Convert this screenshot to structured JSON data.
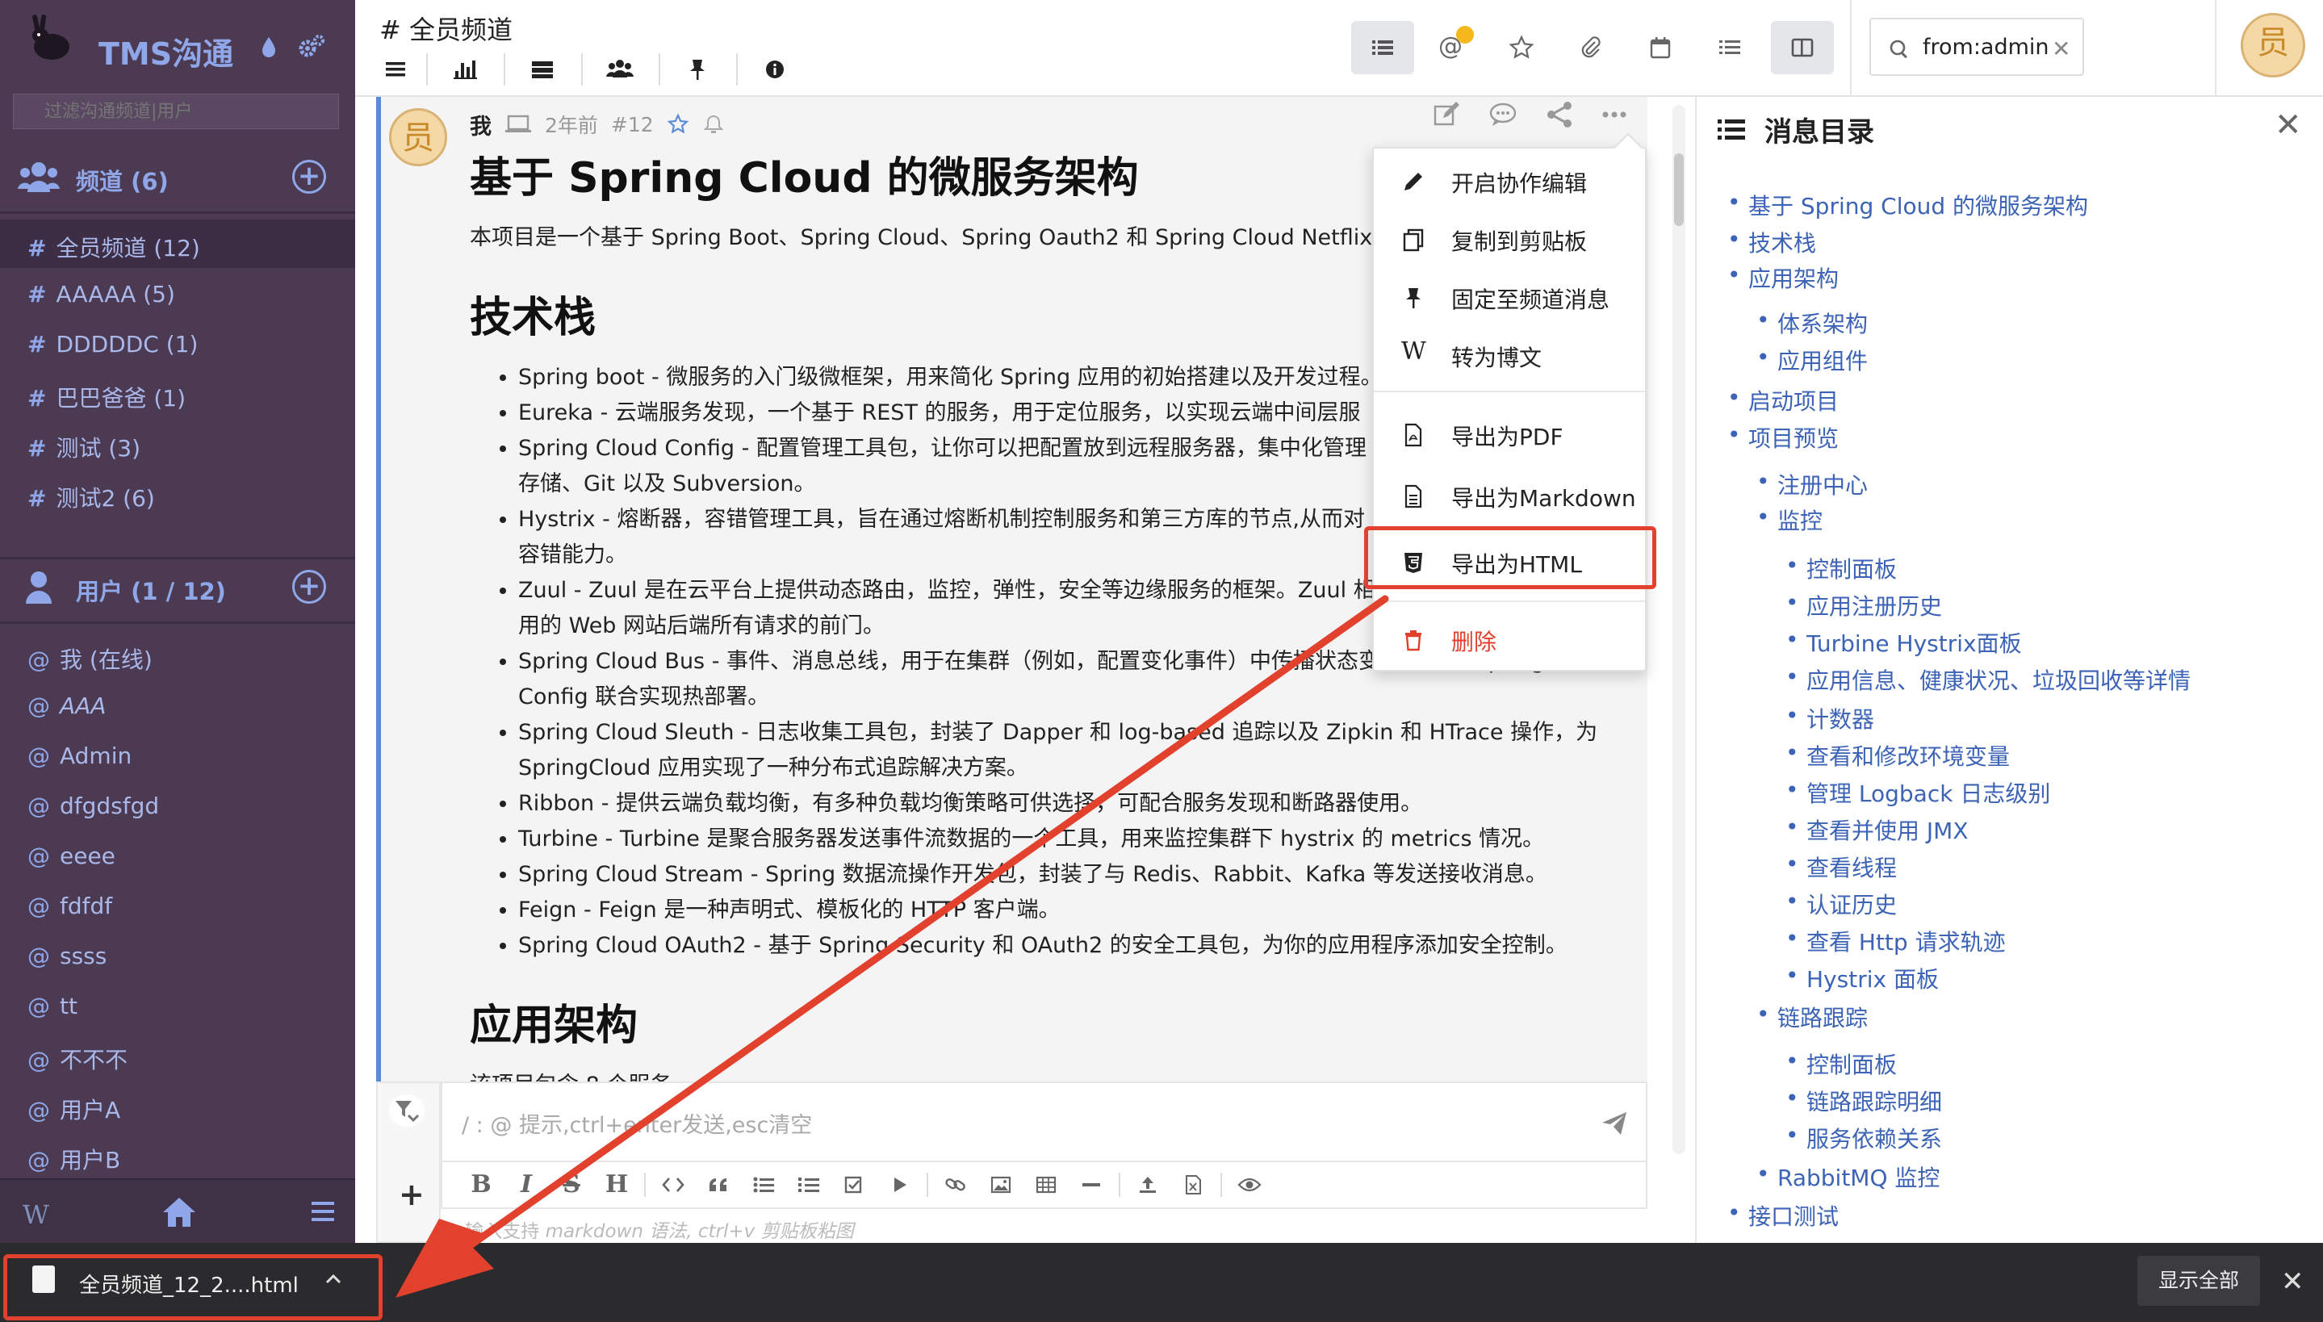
{
  "sidebar": {
    "app_title": "TMS沟通",
    "filter_placeholder": "过滤沟通频道|用户",
    "channels_header": "频道 (6)",
    "channels": [
      {
        "name": "全员频道 (12)",
        "active": true
      },
      {
        "name": "AAAAA (5)",
        "active": false
      },
      {
        "name": "DDDDDC (1)",
        "active": false
      },
      {
        "name": "巴巴爸爸 (1)",
        "active": false
      },
      {
        "name": "测试 (3)",
        "active": false
      },
      {
        "name": "测试2 (6)",
        "active": false
      }
    ],
    "users_header": "用户 (1 / 12)",
    "users": [
      "我 (在线)",
      "AAA",
      "Admin",
      "dfgdsfgd",
      "eeee",
      "fdfdf",
      "ssss",
      "tt",
      "不不不",
      "用户A",
      "用户B"
    ],
    "bottom_w": "W"
  },
  "header": {
    "channel_title": "# 全员频道",
    "search_value": "from:admin",
    "clear": "✕",
    "at_symbol": "@"
  },
  "message": {
    "author": "我",
    "time": "2年前",
    "index": "#12",
    "avatar_char": "员",
    "h1": "基于 Spring Cloud 的微服务架构",
    "intro": "本项目是一个基于 Spring Boot、Spring Cloud、Spring Oauth2 和 Spring Cloud Netflix 等框",
    "h2_stack": "技术栈",
    "stack_items": [
      "Spring boot - 微服务的入门级微框架，用来简化 Spring 应用的初始搭建以及开发过程。",
      "Eureka - 云端服务发现，一个基于 REST 的服务，用于定位服务，以实现云端中间层服",
      "Spring Cloud Config - 配置管理工具包，让你可以把配置放到远程服务器，集中化管理",
      "存储、Git 以及 Subversion。",
      "Hystrix - 熔断器，容错管理工具，旨在通过熔断机制控制服务和第三方库的节点,从而对",
      "容错能力。",
      "Zuul - Zuul 是在云平台上提供动态路由，监控，弹性，安全等边缘服务的框架。Zuul 相",
      "用的 Web 网站后端所有请求的前门。",
      "Spring Cloud Bus - 事件、消息总线，用于在集群（例如，配置变化事件）中传播状态变化，可与 Spring Cloud",
      "Config 联合实现热部署。",
      "Spring Cloud Sleuth - 日志收集工具包，封装了 Dapper 和 log-based 追踪以及 Zipkin 和 HTrace 操作，为",
      "SpringCloud 应用实现了一种分布式追踪解决方案。",
      "Ribbon - 提供云端负载均衡，有多种负载均衡策略可供选择，可配合服务发现和断路器使用。",
      "Turbine - Turbine 是聚合服务器发送事件流数据的一个工具，用来监控集群下 hystrix 的 metrics 情况。",
      "Spring Cloud Stream - Spring 数据流操作开发包，封装了与 Redis、Rabbit、Kafka 等发送接收消息。",
      "Feign - Feign 是一种声明式、模板化的 HTTP 客户端。",
      "Spring Cloud OAuth2 - 基于 Spring Security 和 OAuth2 的安全工具包，为你的应用程序添加安全控制。"
    ],
    "h2_arch": "应用架构",
    "arch_intro": "该项目包含 8 个服务"
  },
  "composer": {
    "placeholder": "/ : @ 提示,ctrl+enter发送,esc清空",
    "hint": "markdown 语法, ctrl+v 剪贴板粘图",
    "hint_prefix": "@ 输入支持",
    "tool_labels": [
      "B",
      "I",
      "S",
      "H"
    ]
  },
  "context_menu": {
    "items": [
      {
        "label": "开启协作编辑",
        "icon": "pencil-icon"
      },
      {
        "label": "复制到剪贴板",
        "icon": "copy-icon"
      },
      {
        "label": "固定至频道消息",
        "icon": "pin-icon"
      },
      {
        "label": "转为博文",
        "icon": "wiki-icon"
      },
      {
        "label": "导出为PDF",
        "icon": "pdf-icon"
      },
      {
        "label": "导出为Markdown",
        "icon": "markdown-file-icon"
      },
      {
        "label": "导出为HTML",
        "icon": "html5-icon"
      },
      {
        "label": "删除",
        "icon": "trash-icon"
      }
    ],
    "highlighted": "导出为HTML"
  },
  "toc": {
    "title": "消息目录",
    "items": [
      {
        "label": "基于 Spring Cloud 的微服务架构",
        "level": 1
      },
      {
        "label": "技术栈",
        "level": 1
      },
      {
        "label": "应用架构",
        "level": 1
      },
      {
        "label": "体系架构",
        "level": 2
      },
      {
        "label": "应用组件",
        "level": 2
      },
      {
        "label": "启动项目",
        "level": 1
      },
      {
        "label": "项目预览",
        "level": 1
      },
      {
        "label": "注册中心",
        "level": 2
      },
      {
        "label": "监控",
        "level": 2
      },
      {
        "label": "控制面板",
        "level": 3
      },
      {
        "label": "应用注册历史",
        "level": 3
      },
      {
        "label": "Turbine Hystrix面板",
        "level": 3
      },
      {
        "label": "应用信息、健康状况、垃圾回收等详情",
        "level": 3
      },
      {
        "label": "计数器",
        "level": 3
      },
      {
        "label": "查看和修改环境变量",
        "level": 3
      },
      {
        "label": "管理 Logback 日志级别",
        "level": 3
      },
      {
        "label": "查看并使用 JMX",
        "level": 3
      },
      {
        "label": "查看线程",
        "level": 3
      },
      {
        "label": "认证历史",
        "level": 3
      },
      {
        "label": "查看 Http 请求轨迹",
        "level": 3
      },
      {
        "label": "Hystrix 面板",
        "level": 3
      },
      {
        "label": "链路跟踪",
        "level": 2
      },
      {
        "label": "控制面板",
        "level": 3
      },
      {
        "label": "链路跟踪明细",
        "level": 3
      },
      {
        "label": "服务依赖关系",
        "level": 3
      },
      {
        "label": "RabbitMQ 监控",
        "level": 2
      },
      {
        "label": "接口测试",
        "level": 1
      }
    ]
  },
  "download_bar": {
    "file_name": "全员频道_12_2....html",
    "show_all": "显示全部",
    "close": "✕"
  },
  "colors": {
    "sidebar_bg": "#4b3a52",
    "accent_blue": "#8fa7e8",
    "link_blue": "#3c63b5",
    "highlight_red": "#e2412d"
  }
}
